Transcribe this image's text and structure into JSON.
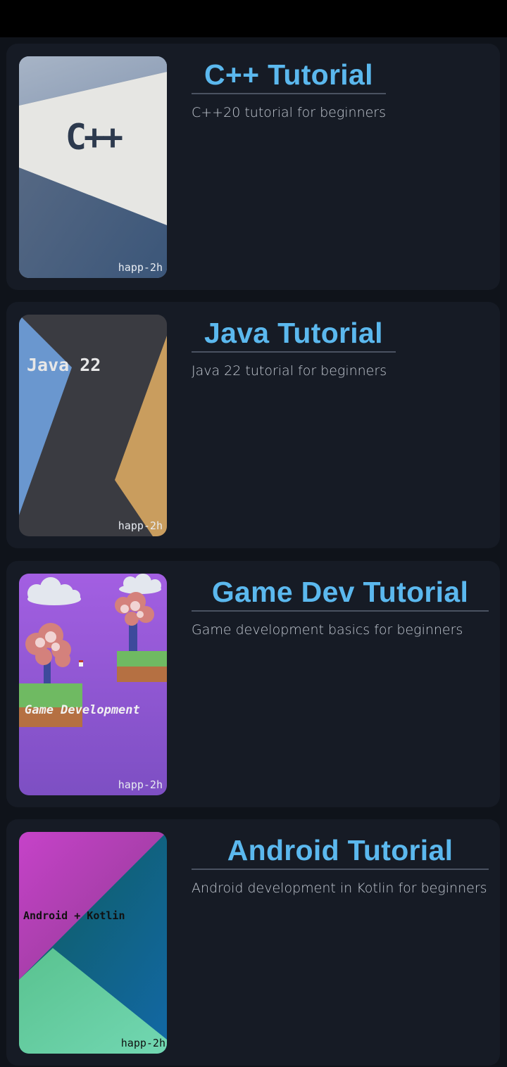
{
  "courses": [
    {
      "title": "C++ Tutorial",
      "description": "C++20 tutorial for beginners",
      "cover_text": "C++",
      "watermark": "happ-2h"
    },
    {
      "title": "Java Tutorial",
      "description": "Java 22 tutorial for beginners",
      "cover_text": "Java 22",
      "watermark": "happ-2h"
    },
    {
      "title": "Game Dev Tutorial",
      "description": "Game development basics for beginners",
      "cover_text": "Game Development",
      "watermark": "happ-2h"
    },
    {
      "title": "Android Tutorial",
      "description": "Android development in Kotlin for beginners",
      "cover_text": "Android + Kotlin",
      "watermark": "happ-2h"
    }
  ],
  "colors": {
    "background": "#0f131a",
    "card": "#161b25",
    "title": "#5bb8ee",
    "description": "#c3c9d2"
  }
}
